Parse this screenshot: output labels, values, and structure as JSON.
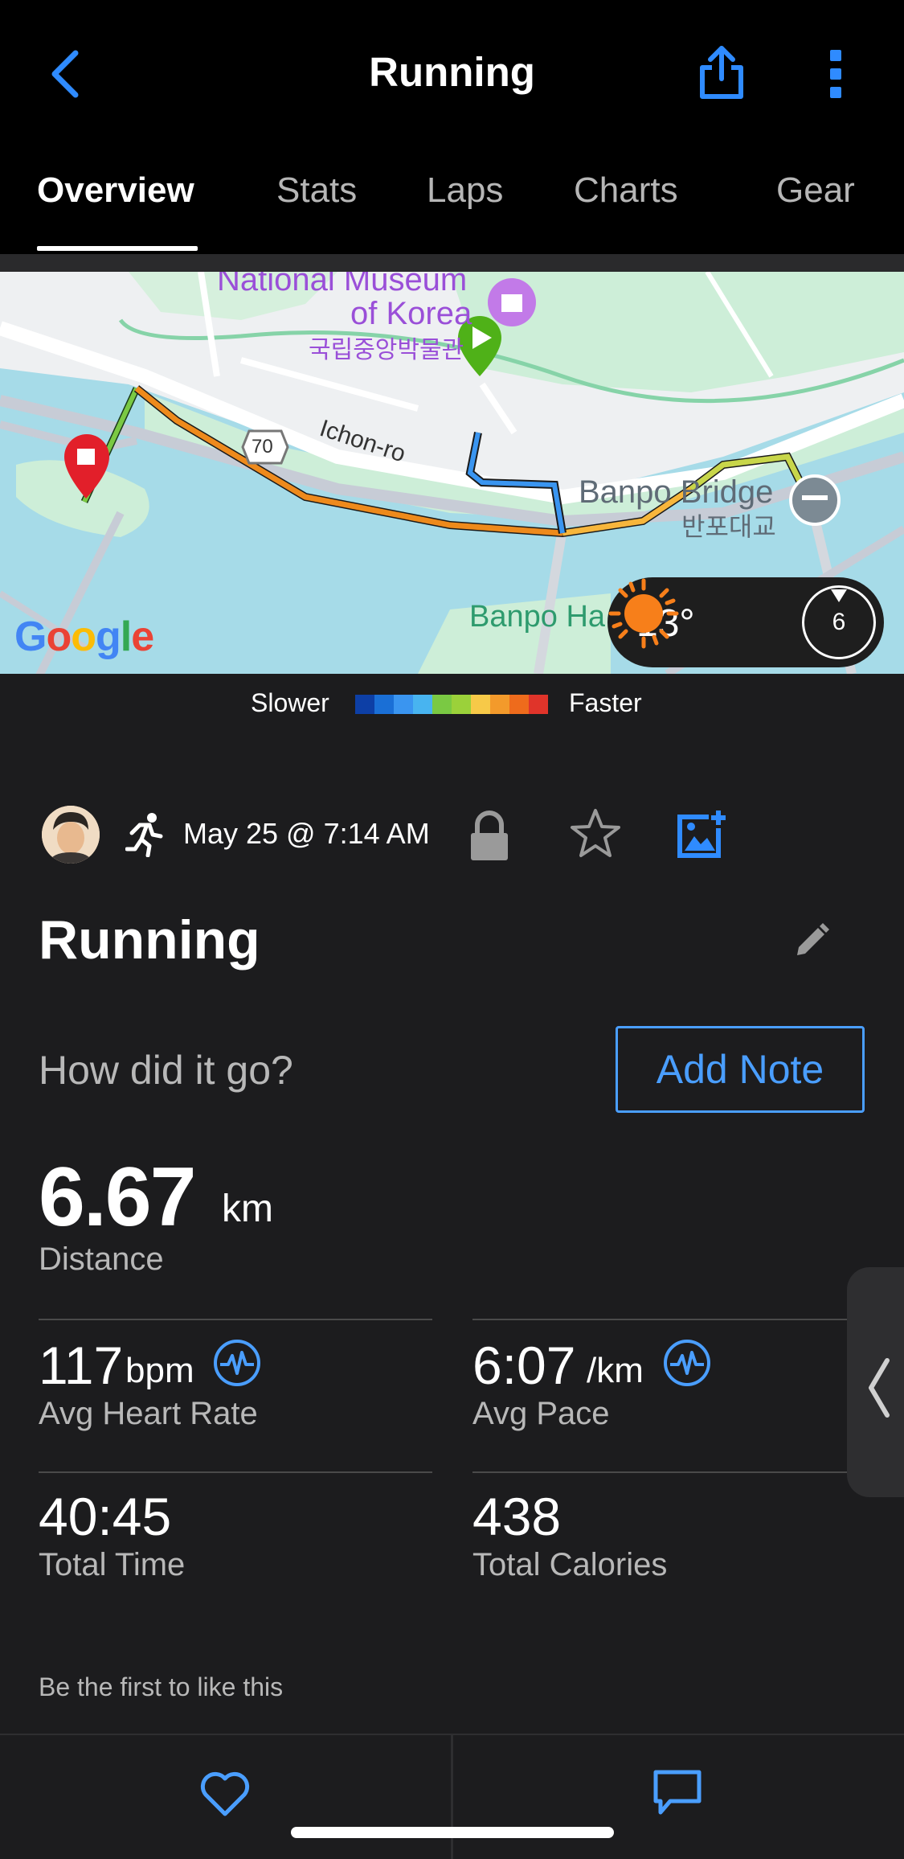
{
  "header": {
    "title": "Running",
    "back_icon": "chevron-left-icon",
    "share_icon": "share-icon",
    "more_icon": "more-vertical-icon"
  },
  "tabs": [
    {
      "label": "Overview",
      "active": true
    },
    {
      "label": "Stats",
      "active": false
    },
    {
      "label": "Laps",
      "active": false
    },
    {
      "label": "Charts",
      "active": false
    },
    {
      "label": "Gear",
      "active": false
    }
  ],
  "map": {
    "labels": {
      "museum_en_1": "National Museum",
      "museum_en_2": "of Korea",
      "museum_ko": "국립중앙박물관",
      "road": "Ichon-ro",
      "route_number": "70",
      "bridge_en": "Banpo Bridge",
      "bridge_ko": "반포대교",
      "park": "Banpo Ha",
      "attribution": "Google"
    },
    "weather": {
      "temperature": "13°",
      "condition_icon": "sun-icon",
      "wind_speed": "6"
    }
  },
  "legend": {
    "slower_label": "Slower",
    "faster_label": "Faster",
    "colors": [
      "#0d3fa6",
      "#1a6fd6",
      "#3a95f0",
      "#48b4f0",
      "#7ac943",
      "#9bd13a",
      "#f7c948",
      "#f39a2b",
      "#ee6b1c",
      "#e0342a"
    ]
  },
  "activity": {
    "date": "May 25 @ 7:14 AM",
    "title": "Running",
    "note_prompt": "How did it go?",
    "add_note_label": "Add Note"
  },
  "stats": {
    "distance": {
      "value": "6.67",
      "unit": "km",
      "label": "Distance"
    },
    "avg_heart_rate": {
      "value": "117",
      "unit": "bpm",
      "label": "Avg Heart Rate"
    },
    "avg_pace": {
      "value": "6:07",
      "unit": "/km",
      "label": "Avg Pace"
    },
    "total_time": {
      "value": "40:45",
      "label": "Total Time"
    },
    "total_calories": {
      "value": "438",
      "label": "Total Calories"
    }
  },
  "social": {
    "likes_text": "Be the first to like this"
  },
  "colors": {
    "accent": "#4a9eff",
    "background": "#1c1c1e",
    "header_bg": "#000000"
  }
}
